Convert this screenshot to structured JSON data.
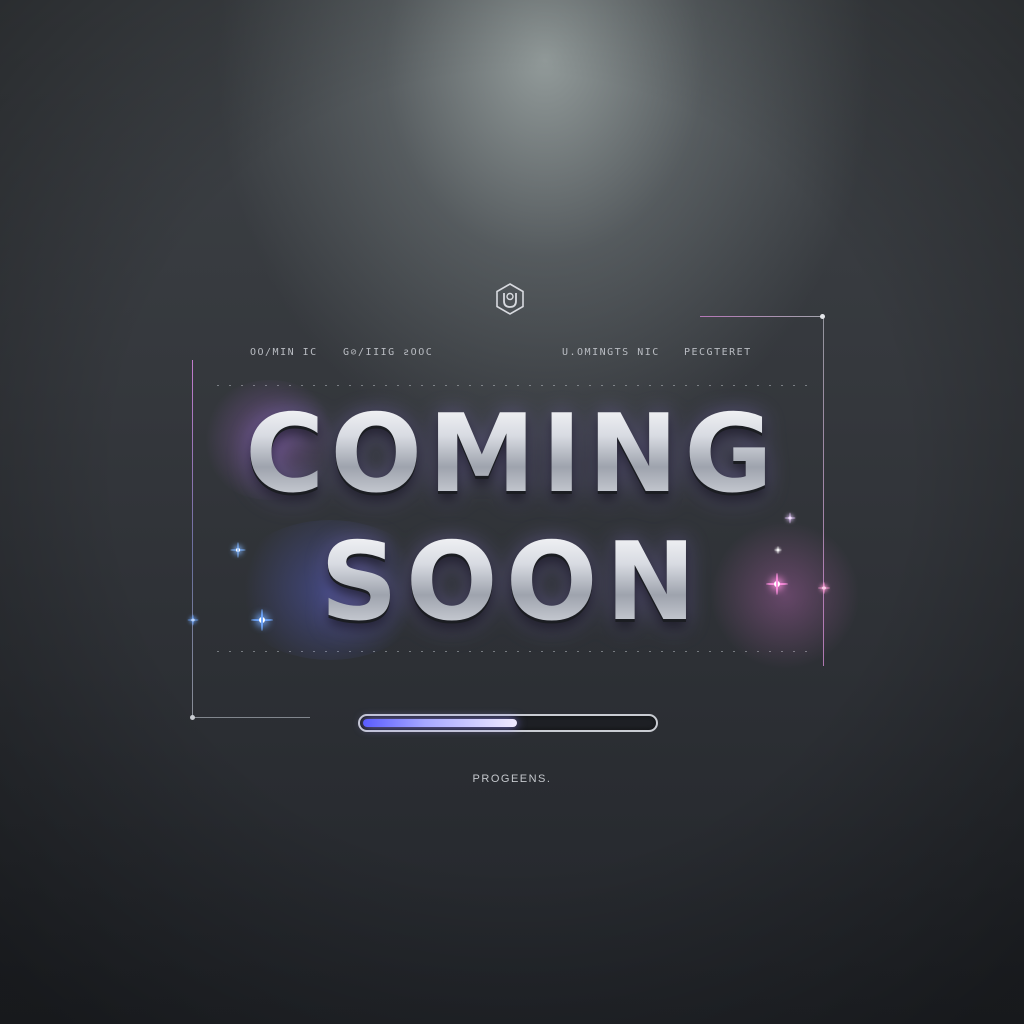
{
  "brand": {
    "logo_icon": "hexagon-u-icon",
    "accent_color": "#8c84ff",
    "highlight_color": "#e07bff"
  },
  "captions": {
    "top_left_1": "OO/MIN IC",
    "top_left_2": "G⊘/IIIG ƨOOC",
    "top_right_1": "U.OMINGTS NIC",
    "top_right_2": "PECGTERET"
  },
  "headline": {
    "line1": "COMING",
    "line2": "SOON"
  },
  "progress": {
    "fraction": 0.53,
    "label": "PROGEENS."
  }
}
